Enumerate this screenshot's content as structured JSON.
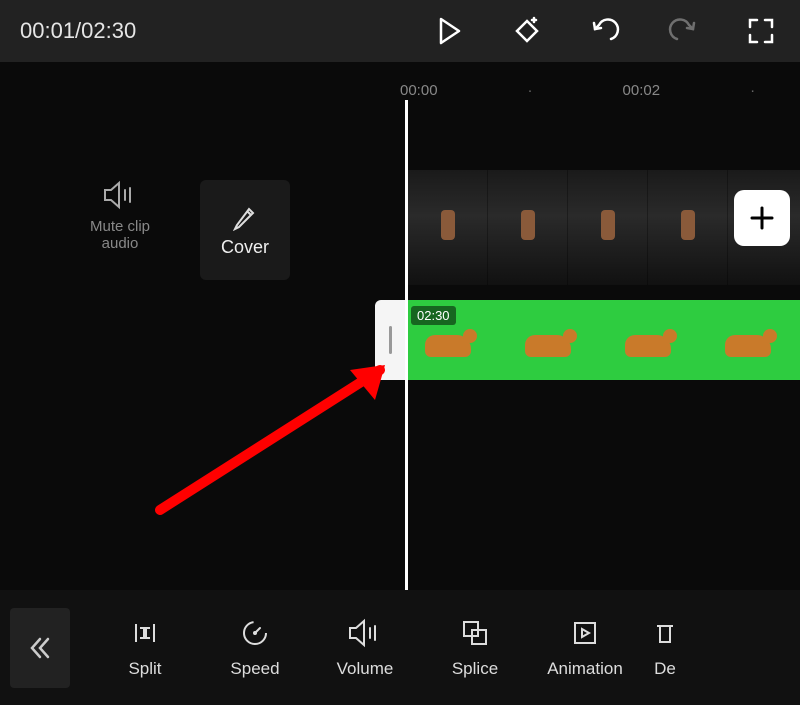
{
  "time": {
    "current": "00:01",
    "total": "02:30",
    "display": "00:01/02:30"
  },
  "ruler": {
    "t0": "00:00",
    "t1": "00:02"
  },
  "sidebar": {
    "mute_label_line1": "Mute clip",
    "mute_label_line2": "audio",
    "cover_label": "Cover"
  },
  "tracks": {
    "green_badge": "02:30"
  },
  "toolbar": {
    "split": "Split",
    "speed": "Speed",
    "volume": "Volume",
    "splice": "Splice",
    "animation": "Animation",
    "delete_partial": "De"
  }
}
